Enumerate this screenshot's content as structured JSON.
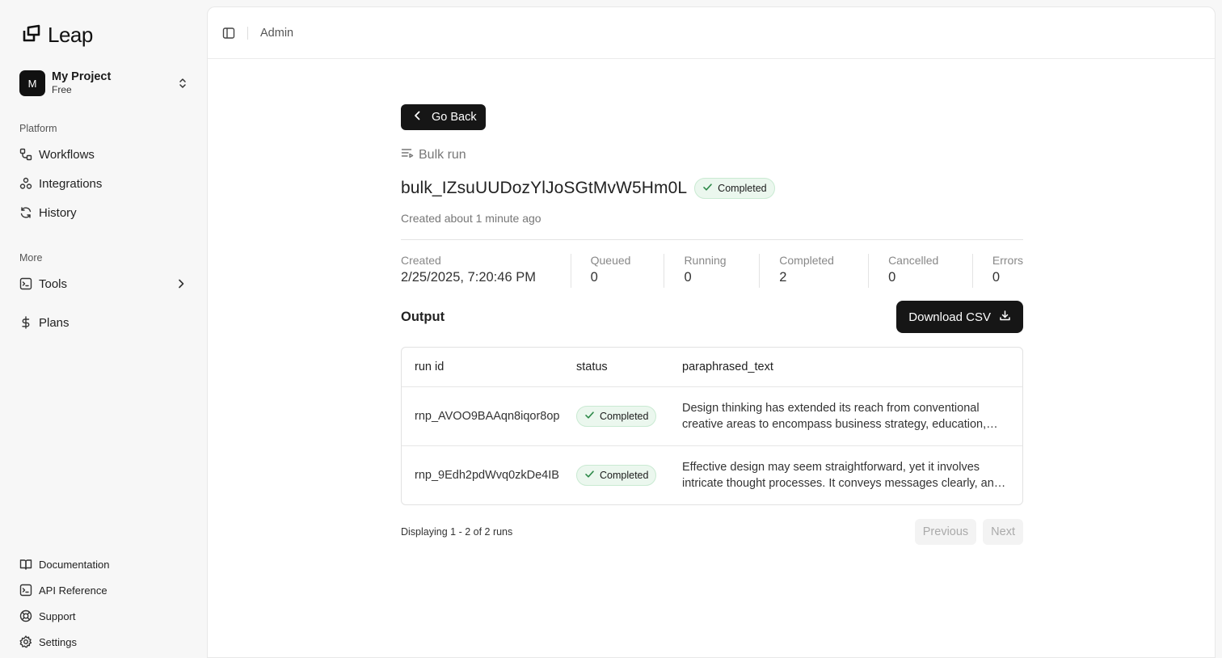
{
  "brand": {
    "name": "Leap"
  },
  "project": {
    "initial": "M",
    "name": "My Project",
    "plan": "Free"
  },
  "sidebar": {
    "platform_label": "Platform",
    "platform_items": [
      {
        "label": "Workflows",
        "icon": "workflow-icon"
      },
      {
        "label": "Integrations",
        "icon": "integrations-icon"
      },
      {
        "label": "History",
        "icon": "history-icon"
      }
    ],
    "more_label": "More",
    "more_items": [
      {
        "label": "Tools",
        "icon": "terminal-icon"
      },
      {
        "label": "Plans",
        "icon": "dollar-icon"
      }
    ],
    "footer_items": [
      {
        "label": "Documentation",
        "icon": "book-icon"
      },
      {
        "label": "API Reference",
        "icon": "terminal-icon"
      },
      {
        "label": "Support",
        "icon": "lifebuoy-icon"
      },
      {
        "label": "Settings",
        "icon": "gear-icon"
      }
    ]
  },
  "header": {
    "breadcrumb": "Admin"
  },
  "page": {
    "back_label": "Go Back",
    "type_label": "Bulk run",
    "run_id": "bulk_IZsuUUDozYlJoSGtMvW5Hm0L",
    "status": "Completed",
    "created_relative": "Created about 1 minute ago",
    "stats": [
      {
        "label": "Created",
        "value": "2/25/2025, 7:20:46 PM"
      },
      {
        "label": "Queued",
        "value": "0"
      },
      {
        "label": "Running",
        "value": "0"
      },
      {
        "label": "Completed",
        "value": "2"
      },
      {
        "label": "Cancelled",
        "value": "0"
      },
      {
        "label": "Errors",
        "value": "0"
      }
    ],
    "output_title": "Output",
    "download_label": "Download CSV",
    "table": {
      "columns": [
        "run id",
        "status",
        "paraphrased_text"
      ],
      "rows": [
        {
          "run_id": "rnp_AVOO9BAAqn8iqor8op",
          "status": "Completed",
          "text": "Design thinking has extended its reach from conventional creative areas to encompass business strategy, education, and beyond"
        },
        {
          "run_id": "rnp_9Edh2pdWvq0zkDe4IB",
          "status": "Completed",
          "text": "Effective design may seem straightforward, yet it involves intricate thought processes. It conveys messages clearly, and with purpose"
        }
      ]
    },
    "pagination": {
      "info": "Displaying 1 - 2 of 2 runs",
      "previous": "Previous",
      "next": "Next"
    }
  },
  "colors": {
    "accent_dark": "#161616",
    "success_bg": "#ebf7ee",
    "success_icon": "#2f8a4a"
  }
}
